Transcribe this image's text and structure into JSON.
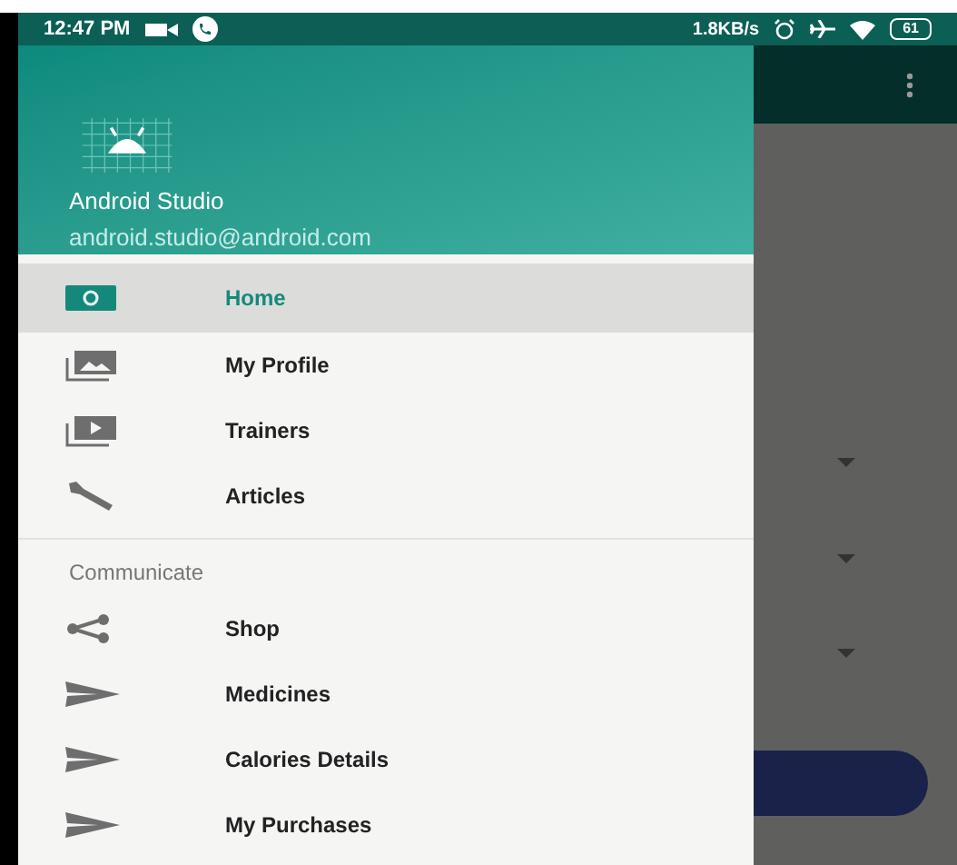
{
  "status_bar": {
    "time": "12:47 PM",
    "speed": "1.8KB/s",
    "battery": "61"
  },
  "drawer": {
    "header": {
      "name": "Android Studio",
      "email": "android.studio@android.com"
    },
    "items": [
      {
        "label": "Home",
        "kind": "camera",
        "selected": true
      },
      {
        "label": "My Profile",
        "kind": "photos",
        "selected": false
      },
      {
        "label": "Trainers",
        "kind": "video",
        "selected": false
      },
      {
        "label": "Articles",
        "kind": "wrench",
        "selected": false
      }
    ],
    "section": "Communicate",
    "section_items": [
      {
        "label": "Shop",
        "kind": "share",
        "selected": false
      },
      {
        "label": "Medicines",
        "kind": "send",
        "selected": false
      },
      {
        "label": "Calories Details",
        "kind": "send",
        "selected": false
      },
      {
        "label": "My Purchases",
        "kind": "send",
        "selected": false
      }
    ]
  }
}
